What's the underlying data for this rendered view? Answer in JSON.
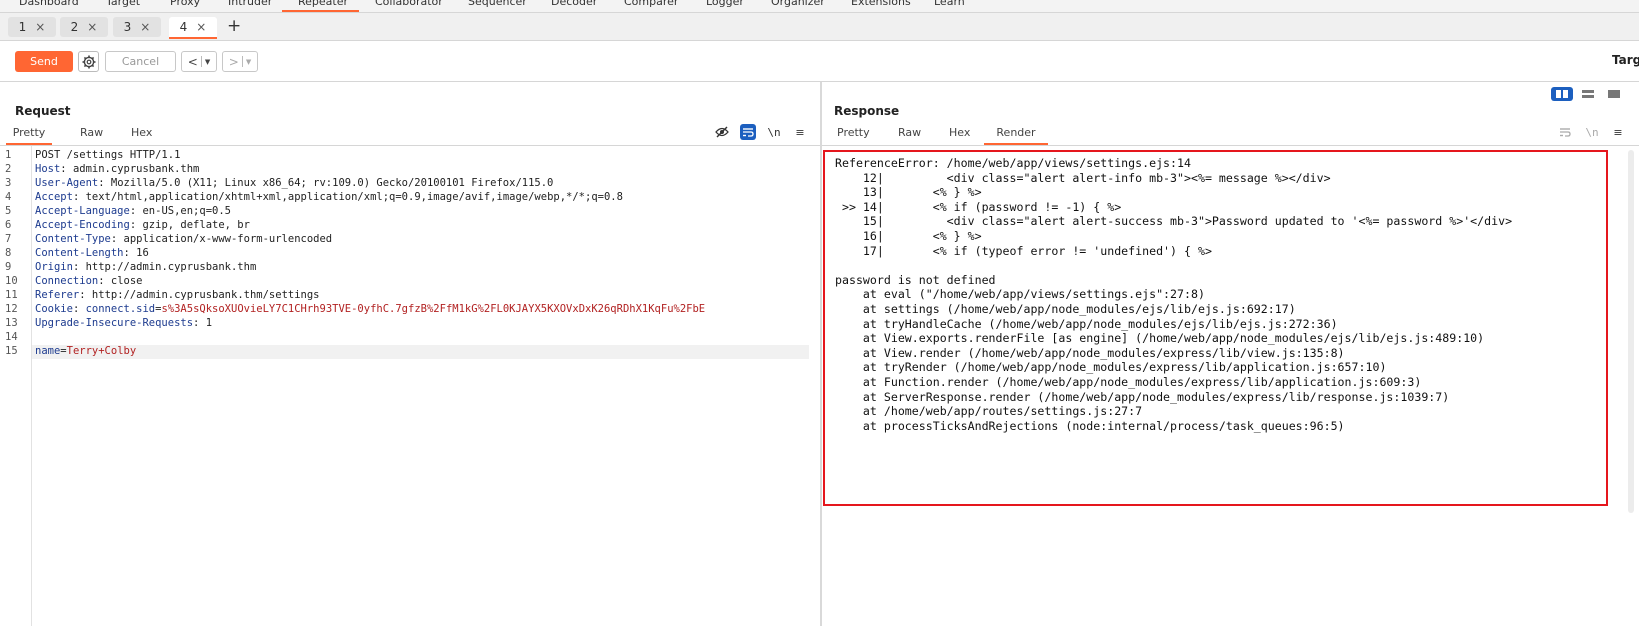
{
  "topnav": [
    "Dashboard",
    "Target",
    "Proxy",
    "Intruder",
    "Repeater",
    "Collaborator",
    "Sequencer",
    "Decoder",
    "Comparer",
    "Logger",
    "Organizer",
    "Extensions",
    "Learn"
  ],
  "tabs": [
    {
      "label": "1",
      "close": "×"
    },
    {
      "label": "2",
      "close": "×"
    },
    {
      "label": "3",
      "close": "×"
    },
    {
      "label": "4",
      "close": "×"
    }
  ],
  "add_tab": "+",
  "toolbar": {
    "send_label": "Send",
    "cancel_label": "Cancel",
    "back_glyph": "<",
    "forward_glyph": ">",
    "dropdown_glyph": "▼",
    "target_label": "Targ"
  },
  "request": {
    "title": "Request",
    "subtabs": [
      "Pretty",
      "Raw",
      "Hex"
    ],
    "newline_icon": "\\n",
    "menu_icon": "≡",
    "lines": [
      {
        "n": "1",
        "text": "POST /settings HTTP/1.1"
      },
      {
        "n": "2",
        "key": "Host",
        "val": "admin.cyprusbank.thm"
      },
      {
        "n": "3",
        "key": "User-Agent",
        "val": "Mozilla/5.0 (X11; Linux x86_64; rv:109.0) Gecko/20100101 Firefox/115.0"
      },
      {
        "n": "4",
        "key": "Accept",
        "val": "text/html,application/xhtml+xml,application/xml;q=0.9,image/avif,image/webp,*/*;q=0.8"
      },
      {
        "n": "5",
        "key": "Accept-Language",
        "val": "en-US,en;q=0.5"
      },
      {
        "n": "6",
        "key": "Accept-Encoding",
        "val": "gzip, deflate, br"
      },
      {
        "n": "7",
        "key": "Content-Type",
        "val": "application/x-www-form-urlencoded"
      },
      {
        "n": "8",
        "key": "Content-Length",
        "val": "16"
      },
      {
        "n": "9",
        "key": "Origin",
        "val": "http://admin.cyprusbank.thm"
      },
      {
        "n": "10",
        "key": "Connection",
        "val": "close"
      },
      {
        "n": "11",
        "key": "Referer",
        "val": "http://admin.cyprusbank.thm/settings"
      },
      {
        "n": "12",
        "key": "Cookie",
        "cookie_name": "connect.sid",
        "cookie_val": "s%3A5sQksoXUOvieLY7C1CHrh93TVE-0yfhC.7gfzB%2FfM1kG%2FL0KJAYX5KXOVxDxK26qRDhX1KqFu%2FbE"
      },
      {
        "n": "13",
        "key": "Upgrade-Insecure-Requests",
        "val": "1"
      },
      {
        "n": "14",
        "text": ""
      },
      {
        "n": "15",
        "param_name": "name",
        "param_val": "Terry+Colby"
      }
    ]
  },
  "response": {
    "title": "Response",
    "subtabs": [
      "Pretty",
      "Raw",
      "Hex",
      "Render"
    ],
    "newline_icon": "\\n",
    "menu_icon": "≡",
    "lines": [
      "ReferenceError: /home/web/app/views/settings.ejs:14",
      "    12|         <div class=\"alert alert-info mb-3\"><%= message %></div>",
      "    13|       <% } %>",
      " >> 14|       <% if (password != -1) { %>",
      "    15|         <div class=\"alert alert-success mb-3\">Password updated to '<%= password %>'</div>",
      "    16|       <% } %>",
      "    17|       <% if (typeof error != 'undefined') { %>",
      "",
      "password is not defined",
      "    at eval (\"/home/web/app/views/settings.ejs\":27:8)",
      "    at settings (/home/web/app/node_modules/ejs/lib/ejs.js:692:17)",
      "    at tryHandleCache (/home/web/app/node_modules/ejs/lib/ejs.js:272:36)",
      "    at View.exports.renderFile [as engine] (/home/web/app/node_modules/ejs/lib/ejs.js:489:10)",
      "    at View.render (/home/web/app/node_modules/express/lib/view.js:135:8)",
      "    at tryRender (/home/web/app/node_modules/express/lib/application.js:657:10)",
      "    at Function.render (/home/web/app/node_modules/express/lib/application.js:609:3)",
      "    at ServerResponse.render (/home/web/app/node_modules/express/lib/response.js:1039:7)",
      "    at /home/web/app/routes/settings.js:27:7",
      "    at processTicksAndRejections (node:internal/process/task_queues:96:5)"
    ]
  },
  "colors": {
    "accent": "#ff6633",
    "highlight_box": "#e5161d",
    "header_key": "#1d3b8f",
    "cookie_value": "#b22222",
    "layout_active": "#1c5fbf"
  }
}
